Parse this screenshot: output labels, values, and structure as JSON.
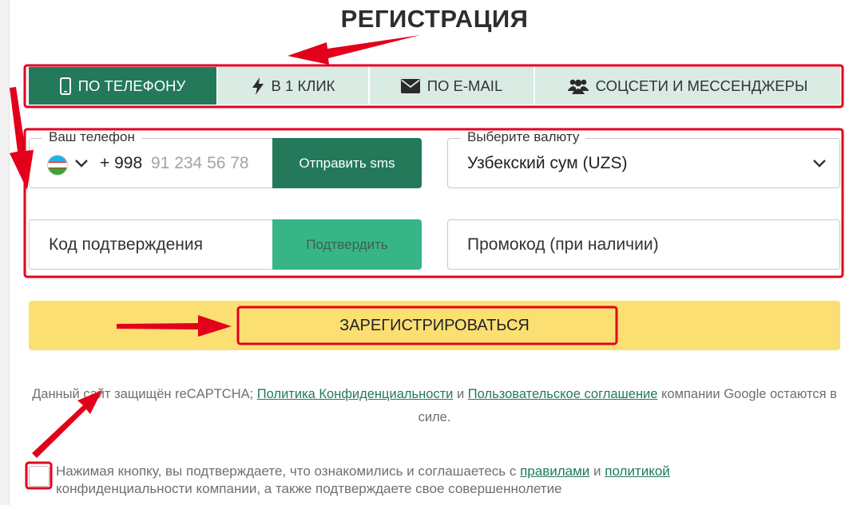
{
  "title": "РЕГИСТРАЦИЯ",
  "tabs": [
    {
      "label": "ПО ТЕЛЕФОНУ",
      "icon": "phone-icon",
      "active": true
    },
    {
      "label": "В 1 КЛИК",
      "icon": "lightning-icon",
      "active": false
    },
    {
      "label": "ПО E-MAIL",
      "icon": "envelope-icon",
      "active": false
    },
    {
      "label": "СОЦСЕТИ И МЕССЕНДЖЕРЫ",
      "icon": "users-icon",
      "active": false
    }
  ],
  "phone": {
    "legend": "Ваш телефон",
    "country_flag": "uzbekistan-flag",
    "code": "+ 998",
    "placeholder": "91 234 56 78",
    "send_button": "Отправить sms"
  },
  "currency": {
    "legend": "Выберите валюту",
    "selected": "Узбекский сум (UZS)"
  },
  "confirmation": {
    "placeholder": "Код подтверждения",
    "button": "Подтвердить"
  },
  "promo": {
    "placeholder": "Промокод (при наличии)"
  },
  "register_button": "ЗАРЕГИСТРИРОВАТЬСЯ",
  "captcha": {
    "text_before": "Данный сайт защищён reCAPTCHA; ",
    "privacy_link": "Политика Конфиденциальности",
    "middle": " и ",
    "terms_link": "Пользовательское соглашение",
    "text_after": " компании Google остаются в силе."
  },
  "consent": {
    "text_before": "Нажимая кнопку, вы подтверждаете, что ознакомились и соглашаетесь с ",
    "rules_link": "правилами",
    "middle": " и ",
    "policy_link": "политикой",
    "text_after": " конфиденциальности компании, а также подтверждаете свое совершеннолетие",
    "checked": false
  },
  "colors": {
    "accent": "#23795a",
    "accent_light": "#37b587",
    "tab_bg": "#d9ebe3",
    "register_bg": "#fcdf73",
    "annotation": "#e3001b"
  }
}
